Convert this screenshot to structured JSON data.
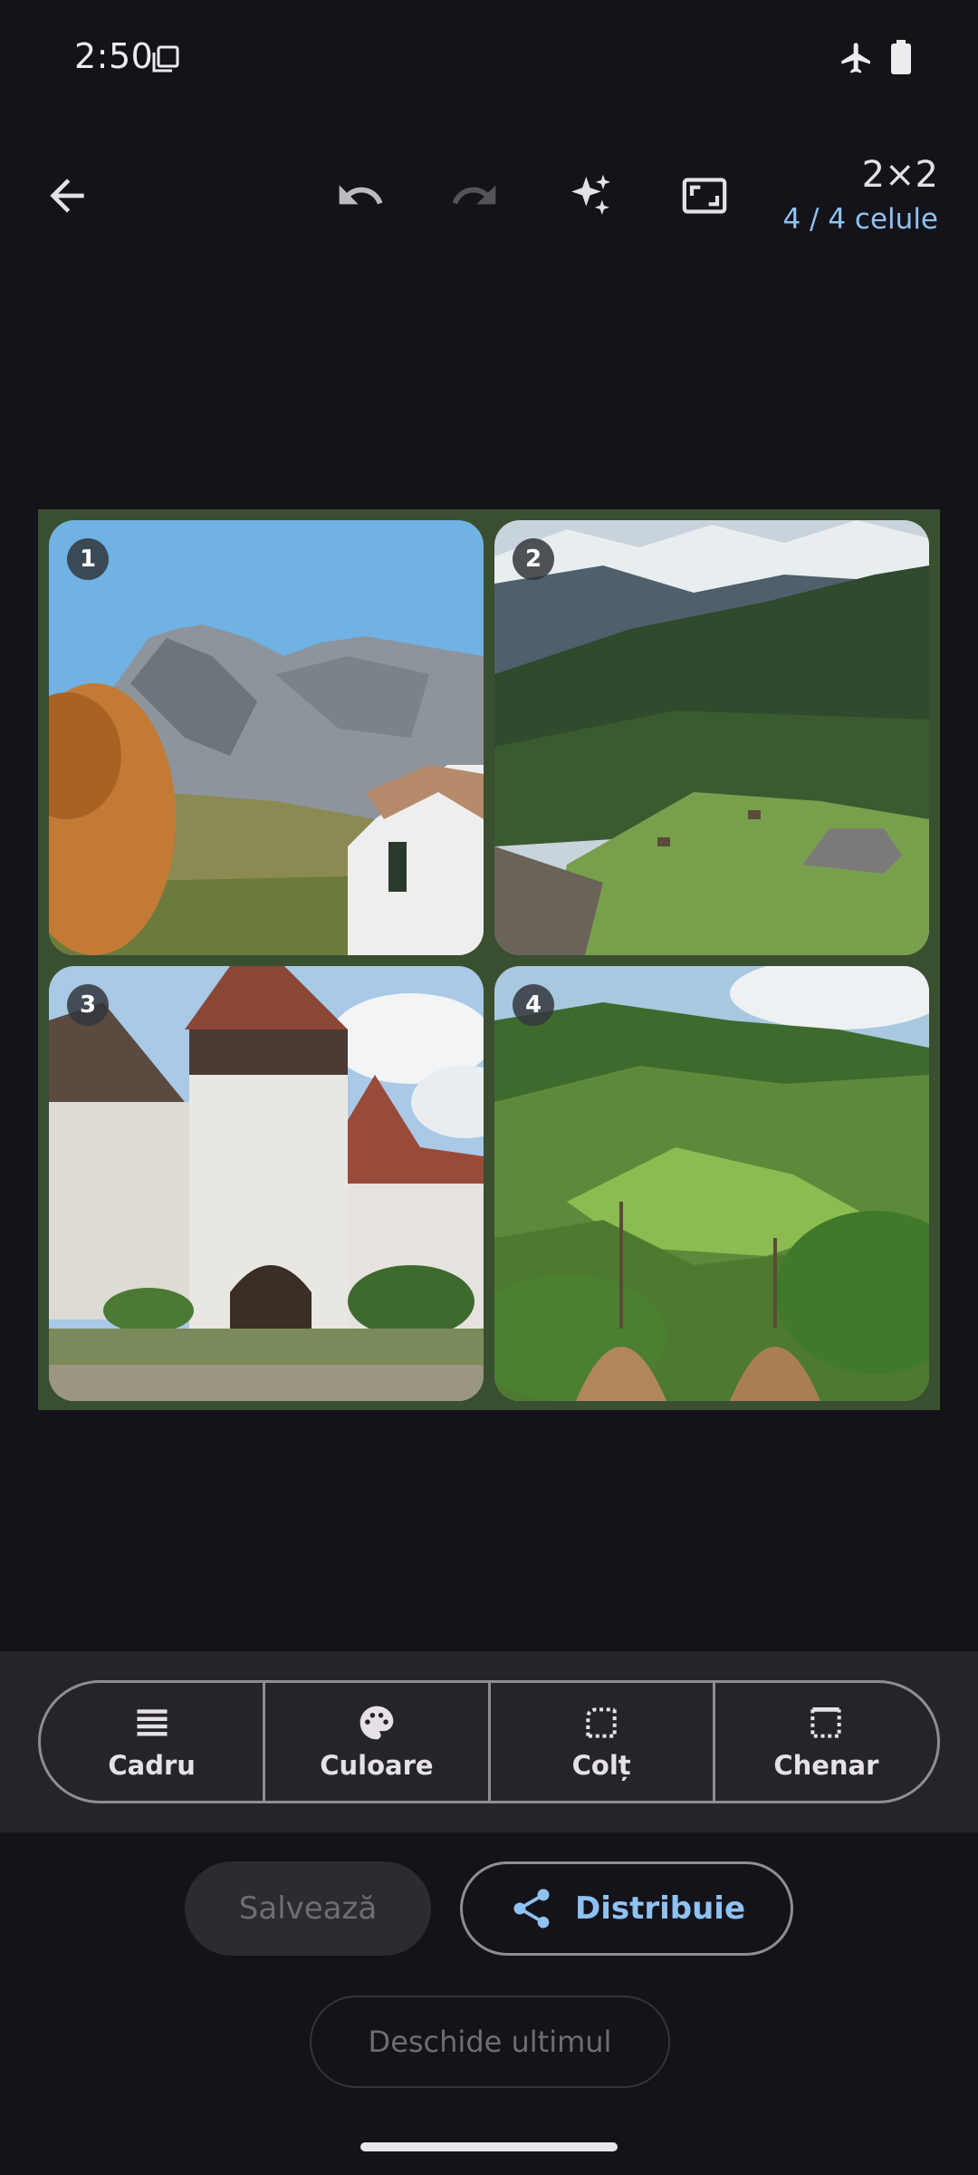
{
  "status_bar": {
    "time": "2:50",
    "icons": [
      "screen-icon",
      "airplane-icon",
      "battery-icon"
    ]
  },
  "toolbar": {
    "icons": [
      "back-arrow-icon",
      "undo-icon",
      "redo-icon",
      "sparkles-icon",
      "crop-frame-icon"
    ],
    "redo_enabled": false,
    "grid_size": "2×2",
    "cell_count": "4 / 4 celule"
  },
  "collage": {
    "background_color": "#3a4e30",
    "cells": [
      {
        "number": "1"
      },
      {
        "number": "2"
      },
      {
        "number": "3"
      },
      {
        "number": "4"
      }
    ]
  },
  "panel": {
    "tabs": [
      {
        "label": "Cadru",
        "icon": "lines-icon"
      },
      {
        "label": "Culoare",
        "icon": "palette-icon"
      },
      {
        "label": "Colț",
        "icon": "corner-icon"
      },
      {
        "label": "Chenar",
        "icon": "border-icon"
      }
    ]
  },
  "actions": {
    "save_label": "Salvează",
    "save_enabled": false,
    "share_label": "Distribuie",
    "share_icon": "share-icon",
    "open_last_label": "Deschide ultimul",
    "open_last_enabled": false
  },
  "colors": {
    "accent": "#8ec2f2",
    "background": "#15131a",
    "panel": "#25242b"
  }
}
